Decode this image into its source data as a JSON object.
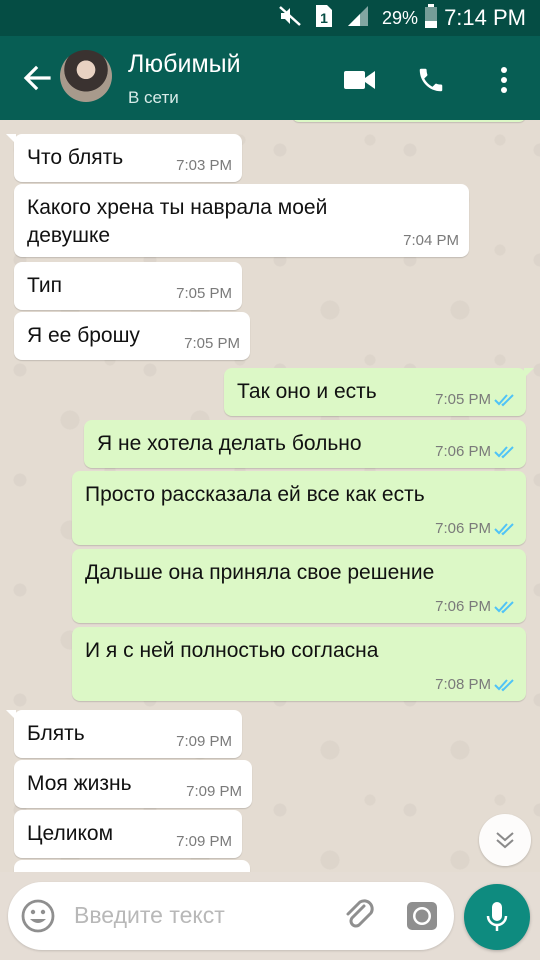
{
  "status_bar": {
    "time": "7:14 PM",
    "battery_percent": "29%",
    "sim_slot": "1"
  },
  "header": {
    "contact_name": "Любимый",
    "status": "В сети"
  },
  "messages": [
    {
      "dir": "in",
      "text": "Что блять",
      "time": "7:03 PM"
    },
    {
      "dir": "in",
      "text": "Какого хрена ты наврала моей девушке",
      "time": "7:04 PM"
    },
    {
      "dir": "in",
      "text": "Тип",
      "time": "7:05 PM"
    },
    {
      "dir": "in",
      "text": "Я ее брошу",
      "time": "7:05 PM"
    },
    {
      "dir": "out",
      "text": "Так оно и есть",
      "time": "7:05 PM",
      "read": true
    },
    {
      "dir": "out",
      "text": "Я не хотела делать больно",
      "time": "7:06 PM",
      "read": true
    },
    {
      "dir": "out",
      "text": "Просто рассказала ей все как есть",
      "time": "7:06 PM",
      "read": true
    },
    {
      "dir": "out",
      "text": "Дальше она приняла свое решение",
      "time": "7:06 PM",
      "read": true
    },
    {
      "dir": "out",
      "text": "И я с ней полностью согласна",
      "time": "7:08 PM",
      "read": true
    },
    {
      "dir": "in",
      "text": "Блять",
      "time": "7:09 PM"
    },
    {
      "dir": "in",
      "text": "Моя жизнь",
      "time": "7:09 PM"
    },
    {
      "dir": "in",
      "text": "Целиком",
      "time": "7:09 PM"
    }
  ],
  "composer": {
    "placeholder": "Введите текст"
  },
  "colors": {
    "header": "#075e54",
    "status_bar": "#054d44",
    "outgoing": "#dcf8c6",
    "incoming": "#ffffff",
    "read_ticks": "#4fc3f7",
    "fab": "#0e8b7f"
  },
  "icons": [
    "back-arrow-icon",
    "video-call-icon",
    "phone-icon",
    "more-vert-icon",
    "emoji-icon",
    "attach-icon",
    "camera-icon",
    "mic-icon",
    "chevron-down-icon",
    "double-check-icon"
  ]
}
